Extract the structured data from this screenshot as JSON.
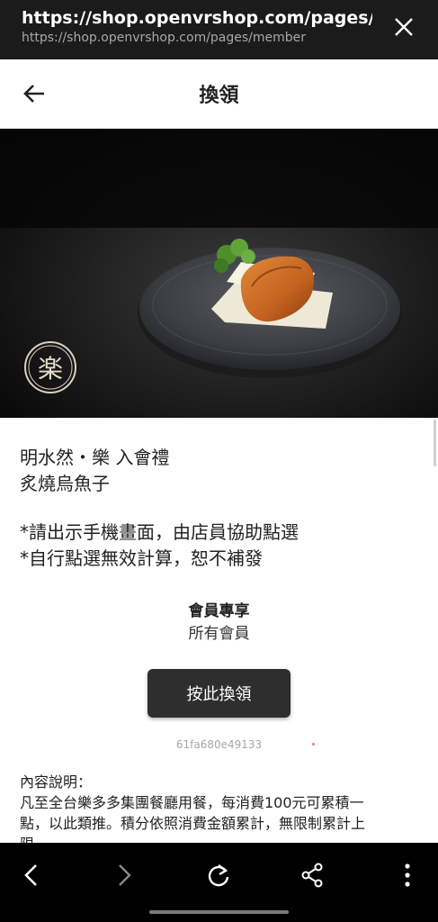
{
  "browser": {
    "title": "https://shop.openvrshop.com/pages/m...",
    "url": "https://shop.openvrshop.com/pages/member",
    "close_icon": "close-icon"
  },
  "header": {
    "title": "換領",
    "back_icon": "arrow-left-icon"
  },
  "hero": {
    "description_icon": "food-photo",
    "logo_text": "楽"
  },
  "item": {
    "name_line1": "明水然・樂 入會禮",
    "name_line2": "炙燒烏魚子",
    "notice_line1": "*請出示手機畫面，由店員協助點選",
    "notice_line2": "*自行點選無效計算，恕不補發"
  },
  "member": {
    "label": "會員專享",
    "value": "所有會員"
  },
  "redeem": {
    "button_label": "按此換領",
    "code": "61fa680e49133"
  },
  "description": {
    "heading": "內容說明：",
    "line1": "凡至全台樂多多集團餐廳用餐，每消費100元可累積一",
    "line2": "點，以此類推。積分依照消費金額累計，無限制累計上",
    "line3": "限。"
  },
  "bottom_nav": {
    "icons": [
      "back-icon",
      "forward-icon",
      "refresh-icon",
      "share-icon",
      "more-icon"
    ]
  }
}
